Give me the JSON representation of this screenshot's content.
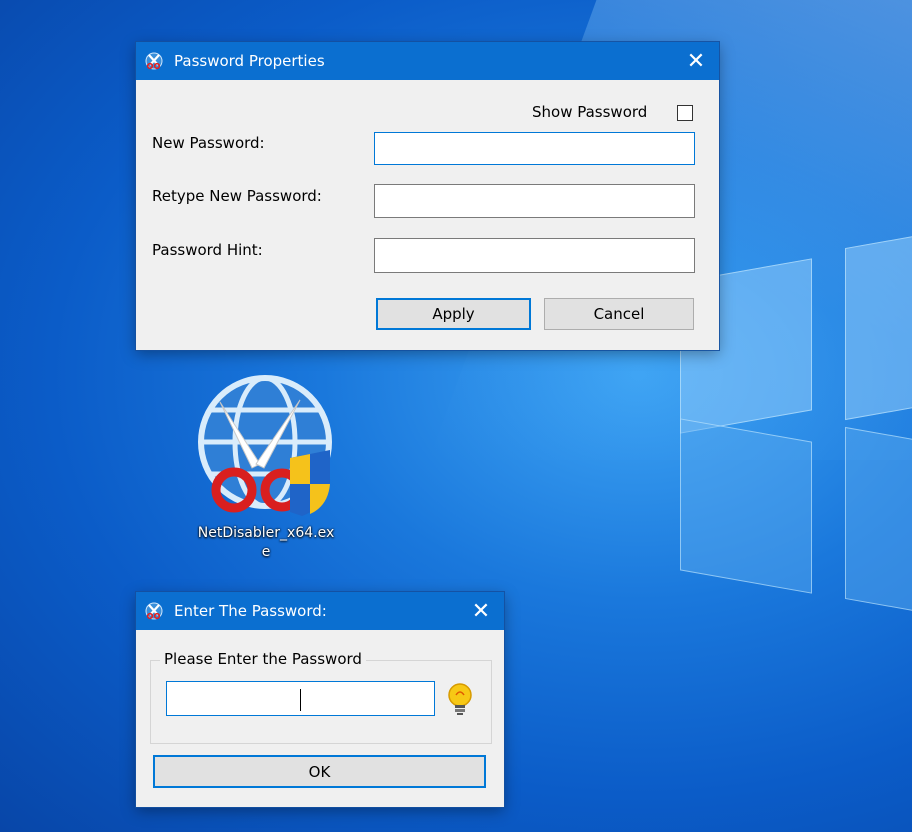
{
  "password_properties": {
    "title": "Password Properties",
    "close_glyph": "✕",
    "show_password_label": "Show Password",
    "show_password_checked": false,
    "fields": [
      {
        "label": "New Password:",
        "value": ""
      },
      {
        "label": "Retype New Password:",
        "value": ""
      },
      {
        "label": "Password Hint:",
        "value": ""
      }
    ],
    "apply_label": "Apply",
    "cancel_label": "Cancel"
  },
  "desktop_icon": {
    "label_line1": "NetDisabler_x64.ex",
    "label_line2": "e",
    "icon": "netdisabler-globe-scissors-shield-icon"
  },
  "enter_password": {
    "title": "Enter The Password:",
    "close_glyph": "✕",
    "group_label": "Please Enter the Password",
    "value": "",
    "hint_icon": "lightbulb-icon",
    "ok_label": "OK"
  },
  "colors": {
    "titlebar": "#0b6fd0",
    "accent_border": "#0078d7",
    "dialog_bg": "#f0f0f0"
  }
}
